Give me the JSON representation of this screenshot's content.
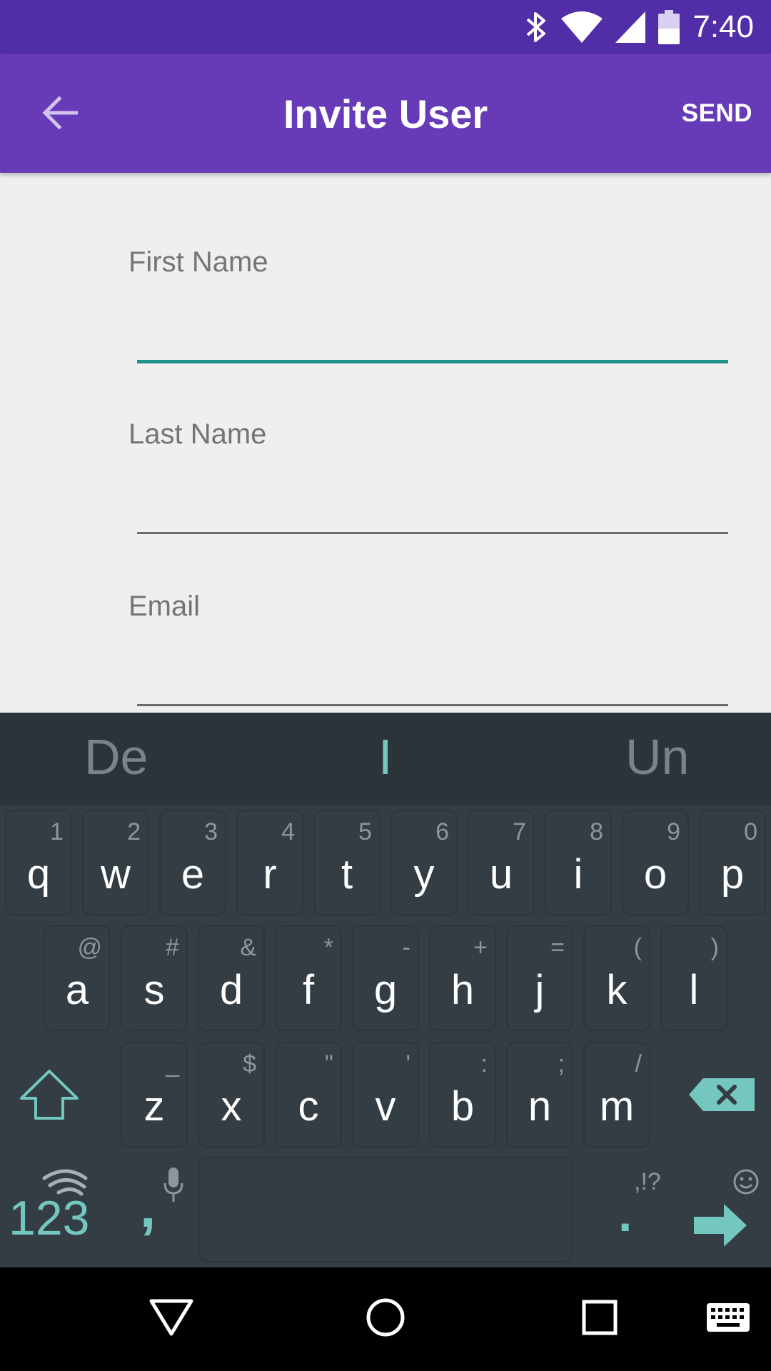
{
  "status_bar": {
    "time": "7:40",
    "icons": [
      "bluetooth-icon",
      "wifi-icon",
      "cell-signal-icon",
      "battery-icon"
    ],
    "background": "#512da8"
  },
  "app_bar": {
    "title": "Invite User",
    "action_label": "SEND",
    "background": "#673ab7"
  },
  "form": {
    "fields": [
      {
        "label": "First Name",
        "value": "",
        "focused": true
      },
      {
        "label": "Last Name",
        "value": ""
      },
      {
        "label": "Email",
        "value": ""
      }
    ],
    "focus_color": "#1e9389"
  },
  "keyboard": {
    "suggestions": [
      "De",
      "I",
      "Un"
    ],
    "row1": [
      {
        "key": "q",
        "hint": "1"
      },
      {
        "key": "w",
        "hint": "2"
      },
      {
        "key": "e",
        "hint": "3"
      },
      {
        "key": "r",
        "hint": "4"
      },
      {
        "key": "t",
        "hint": "5"
      },
      {
        "key": "y",
        "hint": "6"
      },
      {
        "key": "u",
        "hint": "7"
      },
      {
        "key": "i",
        "hint": "8"
      },
      {
        "key": "o",
        "hint": "9"
      },
      {
        "key": "p",
        "hint": "0"
      }
    ],
    "row2": [
      {
        "key": "a",
        "hint": "@"
      },
      {
        "key": "s",
        "hint": "#"
      },
      {
        "key": "d",
        "hint": "&"
      },
      {
        "key": "f",
        "hint": "*"
      },
      {
        "key": "g",
        "hint": "-"
      },
      {
        "key": "h",
        "hint": "+"
      },
      {
        "key": "j",
        "hint": "="
      },
      {
        "key": "k",
        "hint": "("
      },
      {
        "key": "l",
        "hint": ")"
      }
    ],
    "row3": [
      {
        "key": "z",
        "hint": "_"
      },
      {
        "key": "x",
        "hint": "$"
      },
      {
        "key": "c",
        "hint": "\""
      },
      {
        "key": "v",
        "hint": "'"
      },
      {
        "key": "b",
        "hint": ":"
      },
      {
        "key": "n",
        "hint": ";"
      },
      {
        "key": "m",
        "hint": "/"
      }
    ],
    "numbers_label": "123",
    "comma_label": ",",
    "period_label": ".",
    "punctuation_hint": ",!?",
    "accent_color": "#74c7bf"
  },
  "nav_bar": {
    "icons": [
      "back-triangle-icon",
      "home-circle-icon",
      "recents-square-icon",
      "keyboard-icon"
    ]
  }
}
